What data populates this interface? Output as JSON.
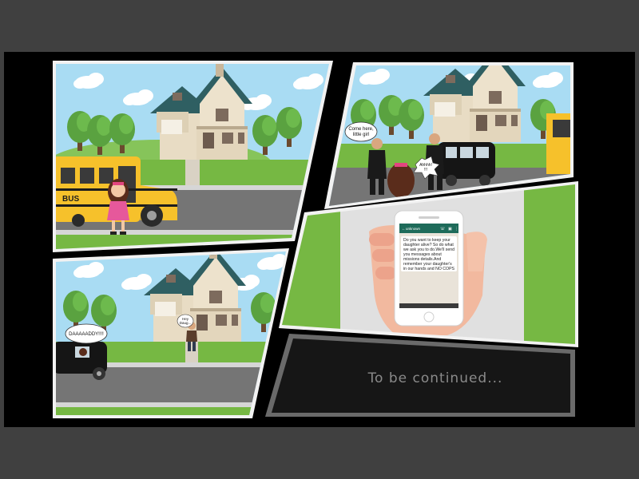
{
  "comic": {
    "panel1": {
      "bus_label": "BUS"
    },
    "panel2": {
      "speech_man": [
        "Come here,",
        "little girl"
      ],
      "speech_girl": [
        "Ahhhh!",
        "!!!"
      ]
    },
    "panel3": {
      "speech_girl": "DAAAAADDY!!!!",
      "speech_dad": [
        "Hey",
        "Daug..."
      ]
    },
    "panel4": {
      "contact_name": "unknown",
      "message_lines": [
        "Do you want to keep your",
        "daughter alive? So do what",
        "we ask you to do.We'll send",
        "you messages about",
        "missions details.And",
        "remember your daughter's",
        "in our hands and NO COPS"
      ]
    },
    "panel5": {
      "caption": "To be continued..."
    }
  },
  "colors": {
    "sky": "#a9dcf3",
    "grass": "#76b843",
    "road": "#757575",
    "bus_yellow": "#f6c12b",
    "roof": "#2c5a5d",
    "house_wall": "#e6d9c1",
    "phone_header": "#1e6b5a",
    "panel_border": "#f2f2f2"
  }
}
